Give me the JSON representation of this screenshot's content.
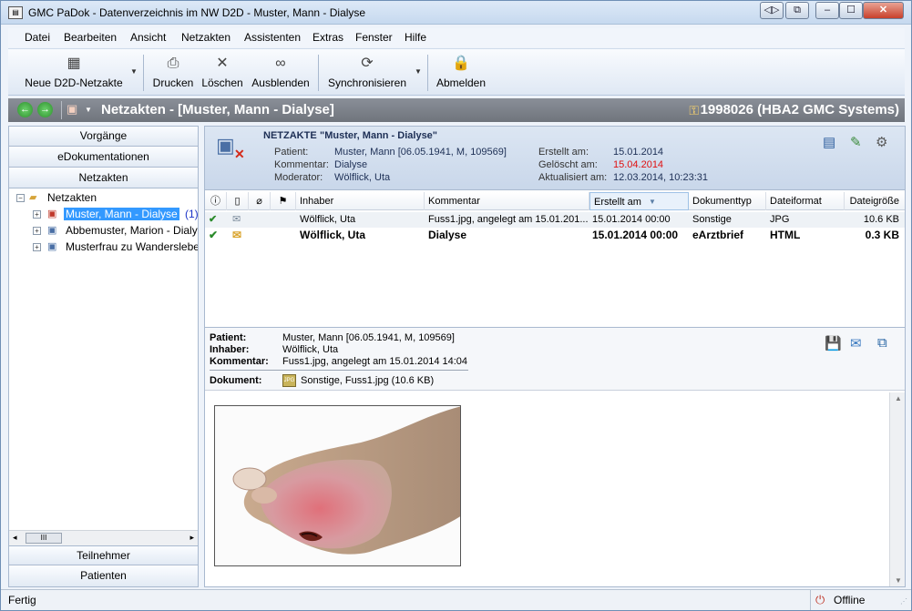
{
  "window": {
    "title": "GMC PaDok - Datenverzeichnis im NW D2D - Muster, Mann - Dialyse"
  },
  "menu": [
    "Datei",
    "Bearbeiten",
    "Ansicht",
    "Netzakten",
    "Assistenten",
    "Extras",
    "Fenster",
    "Hilfe"
  ],
  "toolbar": {
    "new": "Neue D2D-Netzakte",
    "print": "Drucken",
    "delete": "Löschen",
    "hide": "Ausblenden",
    "sync": "Synchronisieren",
    "logout": "Abmelden"
  },
  "navbar": {
    "title": "Netzakten - [Muster, Mann - Dialyse]",
    "identity": "1998026 (HBA2 GMC Systems)"
  },
  "left": {
    "top_buttons": [
      "Vorgänge",
      "eDokumentationen",
      "Netzakten"
    ],
    "tree_root": "Netzakten",
    "tree_items": [
      {
        "label": "Muster, Mann - Dialyse",
        "count": "(1)"
      },
      {
        "label": "Abbemuster, Marion - Dialy",
        "count": ""
      },
      {
        "label": "Musterfrau zu Wandersleber",
        "count": ""
      }
    ],
    "bottom_buttons": [
      "Teilnehmer",
      "Patienten"
    ],
    "scroll_label": "III"
  },
  "header": {
    "heading_prefix": "NETZAKTE",
    "heading_name": "\"Muster, Mann - Dialyse\"",
    "labels": {
      "patient": "Patient:",
      "comment": "Kommentar:",
      "moderator": "Moderator:",
      "created": "Erstellt am:",
      "deleted": "Gelöscht am:",
      "updated": "Aktualisiert am:"
    },
    "values": {
      "patient": "Muster, Mann  [06.05.1941, M, 109569]",
      "comment": "Dialyse",
      "moderator": "Wölflick, Uta",
      "created": "15.01.2014",
      "deleted": "15.04.2014",
      "updated": "12.03.2014, 10:23:31"
    }
  },
  "table": {
    "columns": [
      "Inhaber",
      "Kommentar",
      "Erstellt am",
      "Dokumenttyp",
      "Dateiformat",
      "Dateigröße"
    ],
    "rows": [
      {
        "owner": "Wölflick, Uta",
        "comment": "Fuss1.jpg, angelegt am 15.01.201...",
        "created": "15.01.2014 00:00",
        "type": "Sonstige",
        "format": "JPG",
        "size": "10.6 KB",
        "bold": false
      },
      {
        "owner": "Wölflick, Uta",
        "comment": "Dialyse",
        "created": "15.01.2014 00:00",
        "type": "eArztbrief",
        "format": "HTML",
        "size": "0.3 KB",
        "bold": true
      }
    ]
  },
  "detail": {
    "labels": {
      "patient": "Patient:",
      "owner": "Inhaber:",
      "comment": "Kommentar:",
      "document": "Dokument:"
    },
    "values": {
      "patient": "Muster, Mann  [06.05.1941, M, 109569]",
      "owner": "Wölflick, Uta",
      "comment": "Fuss1.jpg, angelegt am 15.01.2014 14:04",
      "document": "Sonstige,  Fuss1.jpg (10.6 KB)"
    }
  },
  "status": {
    "left": "Fertig",
    "right": "Offline"
  },
  "colors": {
    "deleted_date": "#e01010",
    "selection": "#3399ff",
    "navbar": "#7c8189"
  }
}
